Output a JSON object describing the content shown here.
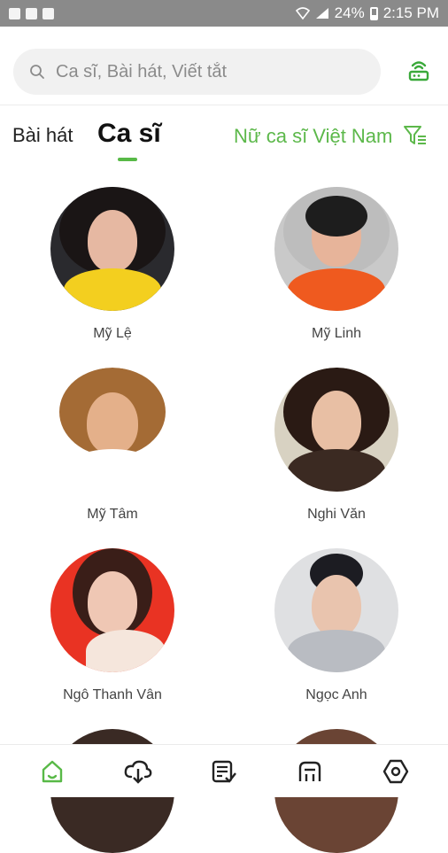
{
  "status_bar": {
    "battery": "24%",
    "time": "2:15 PM"
  },
  "search": {
    "placeholder": "Ca sĩ, Bài hát, Viết tắt"
  },
  "tabs": {
    "songs": "Bài hát",
    "artists": "Ca sĩ",
    "active": "artists"
  },
  "filter": {
    "label": "Nữ ca sĩ Việt Nam"
  },
  "colors": {
    "accent": "#58b947",
    "status_bar": "#8a8a8a"
  },
  "artists": [
    {
      "name": "Mỹ Lệ"
    },
    {
      "name": "Mỹ Linh"
    },
    {
      "name": "Mỹ Tâm"
    },
    {
      "name": "Nghi Văn"
    },
    {
      "name": "Ngô Thanh Vân"
    },
    {
      "name": "Ngọc Anh"
    }
  ],
  "bottom_nav": [
    {
      "icon": "home-icon",
      "active": true
    },
    {
      "icon": "cloud-download-icon",
      "active": false
    },
    {
      "icon": "playlist-check-icon",
      "active": false
    },
    {
      "icon": "router-icon",
      "active": false
    },
    {
      "icon": "settings-hexagon-icon",
      "active": false
    }
  ]
}
